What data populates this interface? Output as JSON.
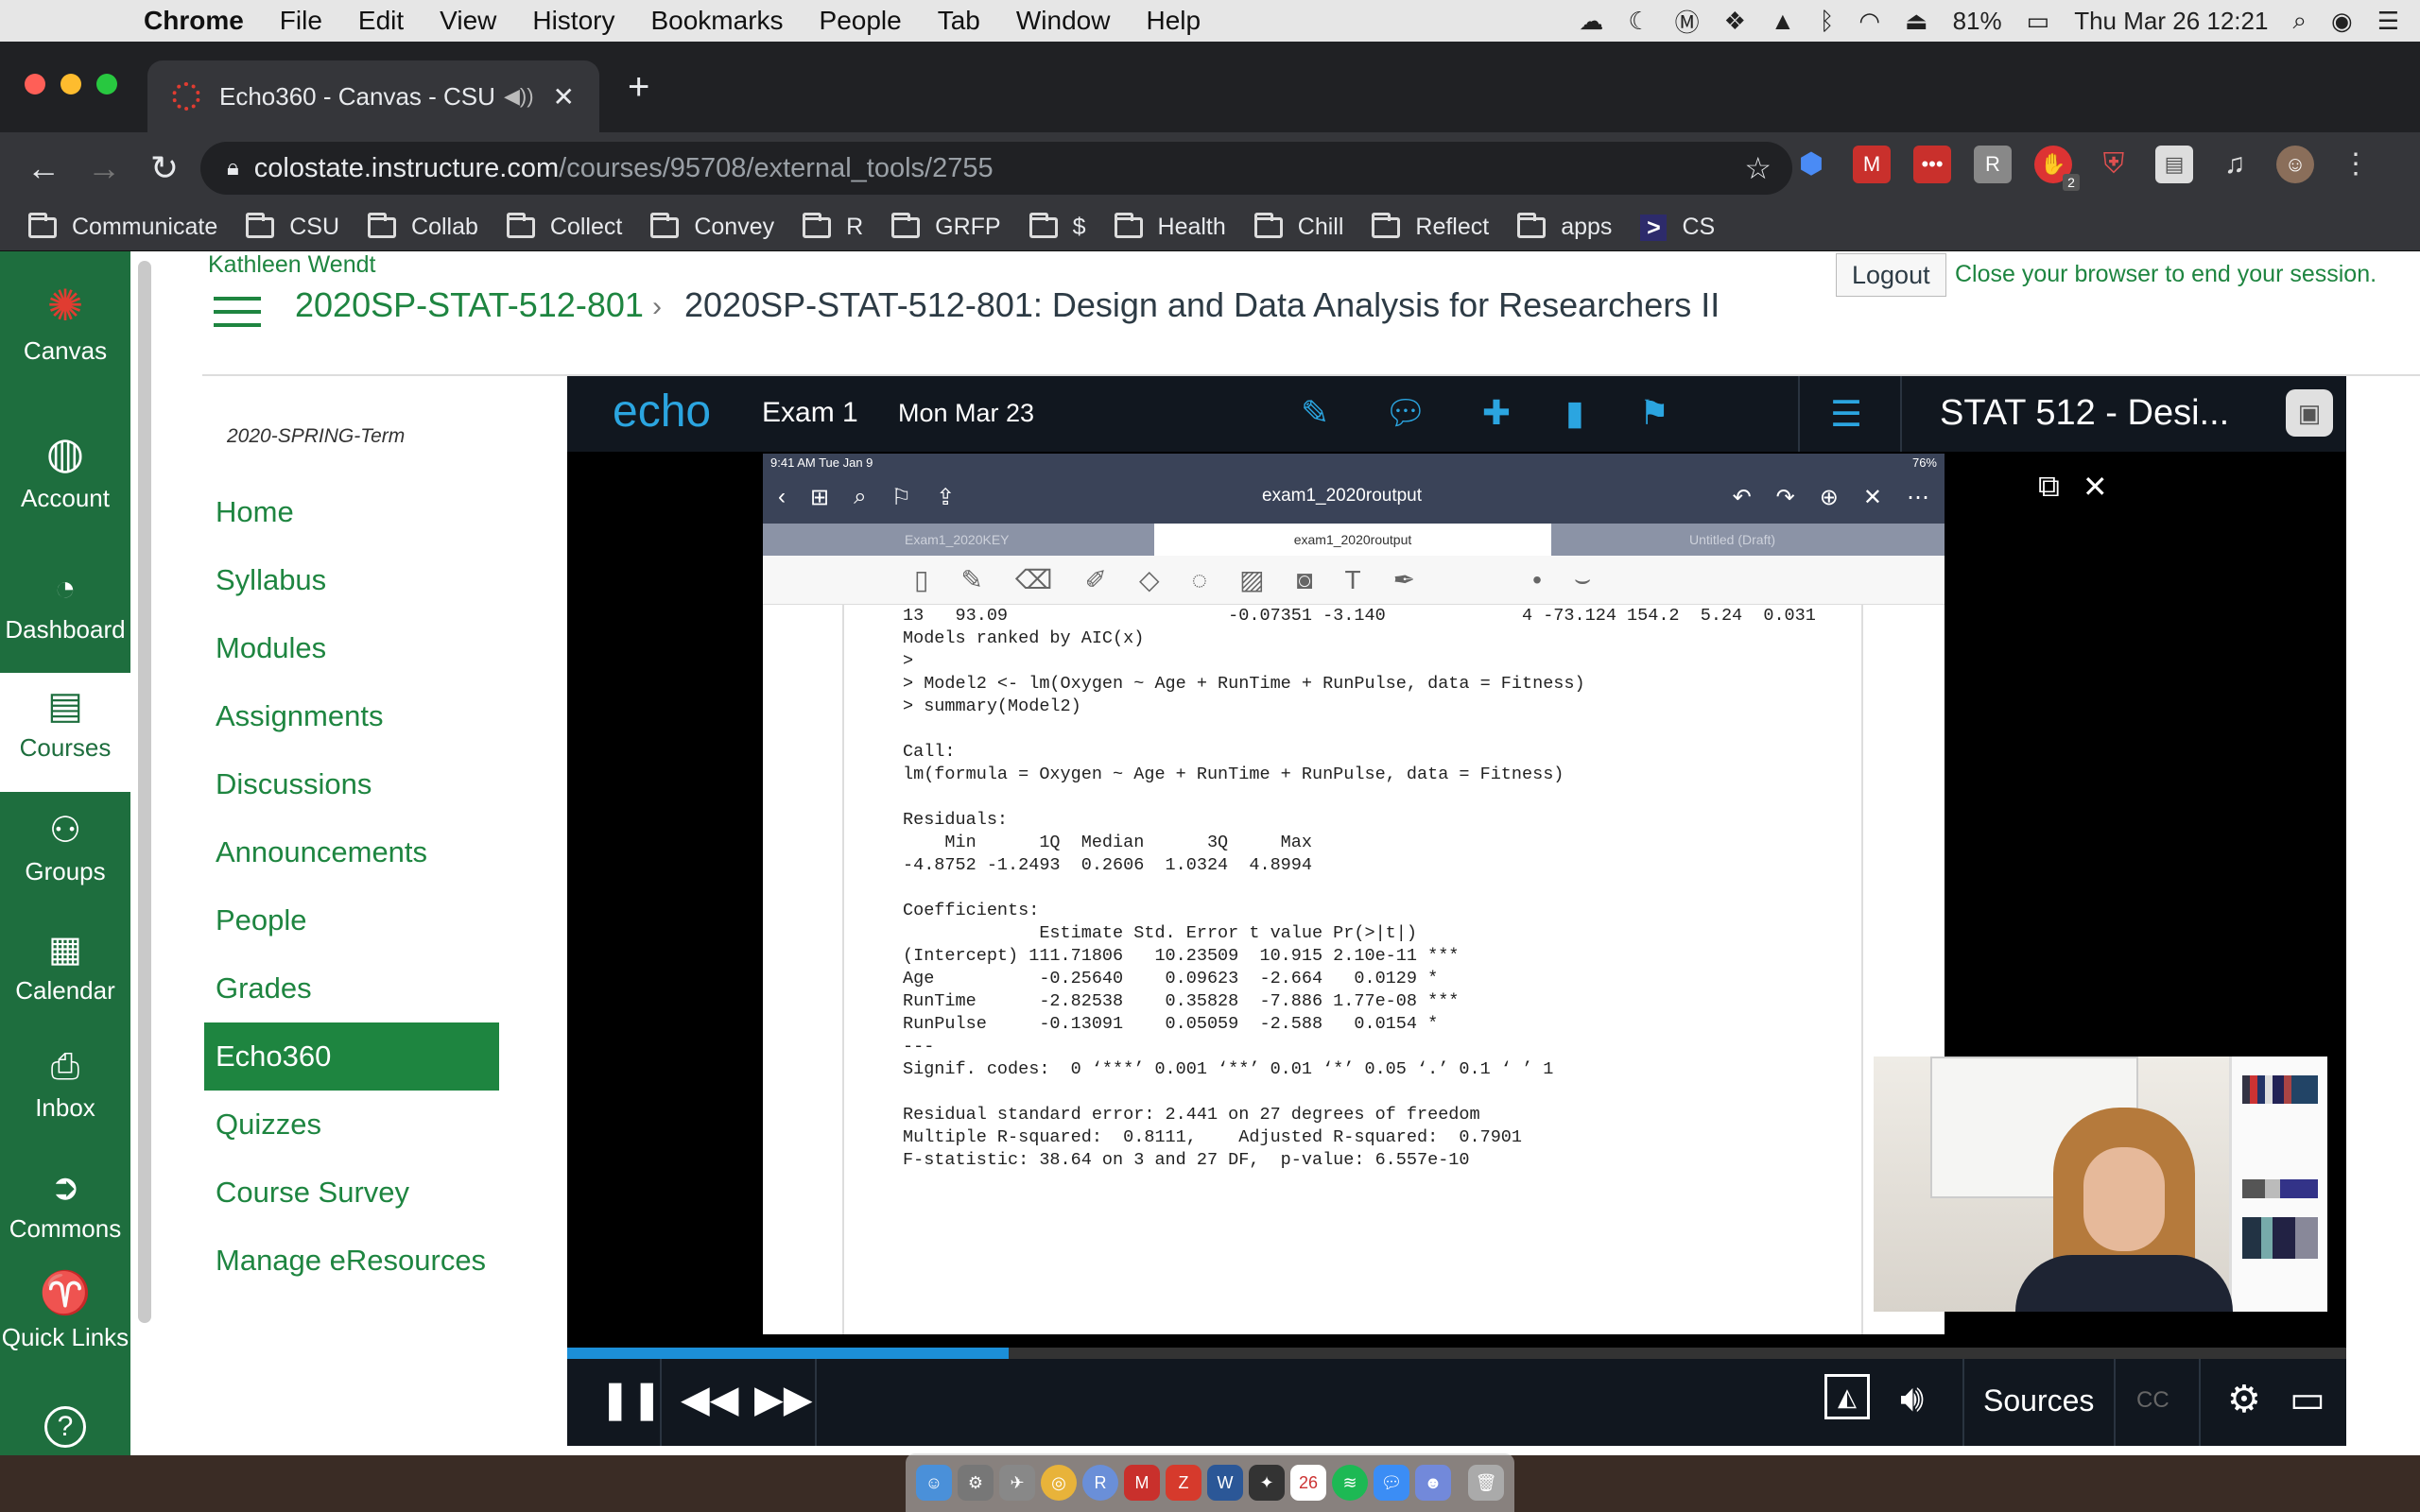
{
  "menubar": {
    "app": "Chrome",
    "items": [
      "File",
      "Edit",
      "View",
      "History",
      "Bookmarks",
      "People",
      "Tab",
      "Window",
      "Help"
    ],
    "battery": "81%",
    "clock": "Thu Mar 26  12:21"
  },
  "browser": {
    "tab_title": "Echo360 - Canvas - CSU",
    "url_host": "colostate.instructure.com",
    "url_path": "/courses/95708/external_tools/2755",
    "bookmarks": [
      "Communicate",
      "CSU",
      "Collab",
      "Collect",
      "Convey",
      "R",
      "GRFP",
      "$",
      "Health",
      "Chill",
      "Reflect",
      "apps",
      "CS"
    ],
    "ext_badge": "2"
  },
  "global_nav": [
    {
      "label": "Canvas"
    },
    {
      "label": "Account"
    },
    {
      "label": "Dashboard"
    },
    {
      "label": "Courses"
    },
    {
      "label": "Groups"
    },
    {
      "label": "Calendar"
    },
    {
      "label": "Inbox"
    },
    {
      "label": "Commons"
    },
    {
      "label": "Quick Links"
    },
    {
      "label": "?"
    }
  ],
  "header": {
    "user": "Kathleen Wendt",
    "crumb_course": "2020SP-STAT-512-801",
    "crumb_title": "2020SP-STAT-512-801: Design and Data Analysis for Researchers II",
    "logout": "Logout",
    "close_msg": "Close your browser to end your session."
  },
  "course_nav": {
    "term": "2020-SPRING-Term",
    "items": [
      "Home",
      "Syllabus",
      "Modules",
      "Assignments",
      "Discussions",
      "Announcements",
      "People",
      "Grades",
      "Echo360",
      "Quizzes",
      "Course Survey",
      "Manage eResources"
    ],
    "active": "Echo360"
  },
  "player": {
    "logo": "echo",
    "title": "Exam 1",
    "date": "Mon Mar 23",
    "course": "STAT 512 - Desi...",
    "progress_fraction": 0.248,
    "sources": "Sources",
    "cc": "CC"
  },
  "ipad": {
    "status_time": "9:41 AM  Tue Jan 9",
    "status_battery": "76%",
    "filename": "exam1_2020routput",
    "tabs": [
      "Exam1_2020KEY",
      "exam1_2020routput",
      "Untitled (Draft)"
    ],
    "r_output": [
      "13   93.09                     -0.07351 -3.140             4 -73.124 154.2  5.24  0.031",
      "Models ranked by AIC(x)",
      ">",
      "> Model2 <- lm(Oxygen ~ Age + RunTime + RunPulse, data = Fitness)",
      "> summary(Model2)",
      "",
      "Call:",
      "lm(formula = Oxygen ~ Age + RunTime + RunPulse, data = Fitness)",
      "",
      "Residuals:",
      "    Min      1Q  Median      3Q     Max",
      "-4.8752 -1.2493  0.2606  1.0324  4.8994",
      "",
      "Coefficients:",
      "             Estimate Std. Error t value Pr(>|t|)",
      "(Intercept) 111.71806   10.23509  10.915 2.10e-11 ***",
      "Age          -0.25640    0.09623  -2.664   0.0129 *",
      "RunTime      -2.82538    0.35828  -7.886 1.77e-08 ***",
      "RunPulse     -0.13091    0.05059  -2.588   0.0154 *",
      "---",
      "Signif. codes:  0 ‘***’ 0.001 ‘**’ 0.01 ‘*’ 0.05 ‘.’ 0.1 ‘ ’ 1",
      "",
      "Residual standard error: 2.441 on 27 degrees of freedom",
      "Multiple R-squared:  0.8111,    Adjusted R-squared:  0.7901",
      "F-statistic: 38.64 on 3 and 27 DF,  p-value: 6.557e-10"
    ]
  }
}
